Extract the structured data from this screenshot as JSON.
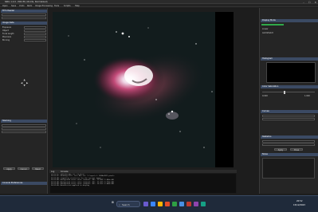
{
  "window": {
    "title": "SIRIL 1.2.0 - M42.fit (16 bits, Normalized)",
    "controls": [
      "–",
      "☐",
      "✕"
    ]
  },
  "menubar": [
    "Open",
    "Save",
    "Undo",
    "Redo",
    "Image Processing",
    "Tools",
    "Scripts",
    "Help"
  ],
  "left_panel": {
    "sections": [
      {
        "title": "FITS Header"
      },
      {
        "title": "Image Data"
      },
      {
        "title": "Stacking"
      },
      {
        "title": "Console Preferences"
      }
    ],
    "fields": [
      "Exposure",
      "Object",
      "Focal length",
      "Pixel size",
      "Binning"
    ],
    "buttons": [
      "Apply",
      "Cancel",
      "Reset"
    ]
  },
  "right_panel": {
    "sections": [
      {
        "title": "Display Mode"
      },
      {
        "title": "Histogram"
      },
      {
        "title": "Color Saturation"
      },
      {
        "title": "Curves"
      },
      {
        "title": "Statistics"
      },
      {
        "title": "Noise"
      }
    ],
    "values": [
      "Linear",
      "AutoStretch",
      "0.000",
      "1.000"
    ],
    "buttons": [
      "Apply",
      "Close"
    ]
  },
  "console": {
    "tabs": [
      "Log",
      "Console"
    ],
    "lines": [
      "20:51:47: Opening M42.fit (16 bits)...",
      "20:51:47: Reading FITS: file M42.fit, 3 layer(s), 4144x2822 pixels",
      "20:51:48: Computing statistics for the current image...",
      "20:51:48: Background noise value (channel: #0): 12.843 (1.960e-04)",
      "20:51:48: Background noise value (channel: #1): 11.207 (1.710e-04)",
      "20:51:48: Background noise value (channel: #2): 13.551 (2.068e-04)",
      "20:51:49: Autostretch applied to display"
    ]
  },
  "taskbar": {
    "search_label": "Search",
    "clock_time": "20:52",
    "clock_date": "15/12/2023",
    "accent": "#3b4a63"
  }
}
